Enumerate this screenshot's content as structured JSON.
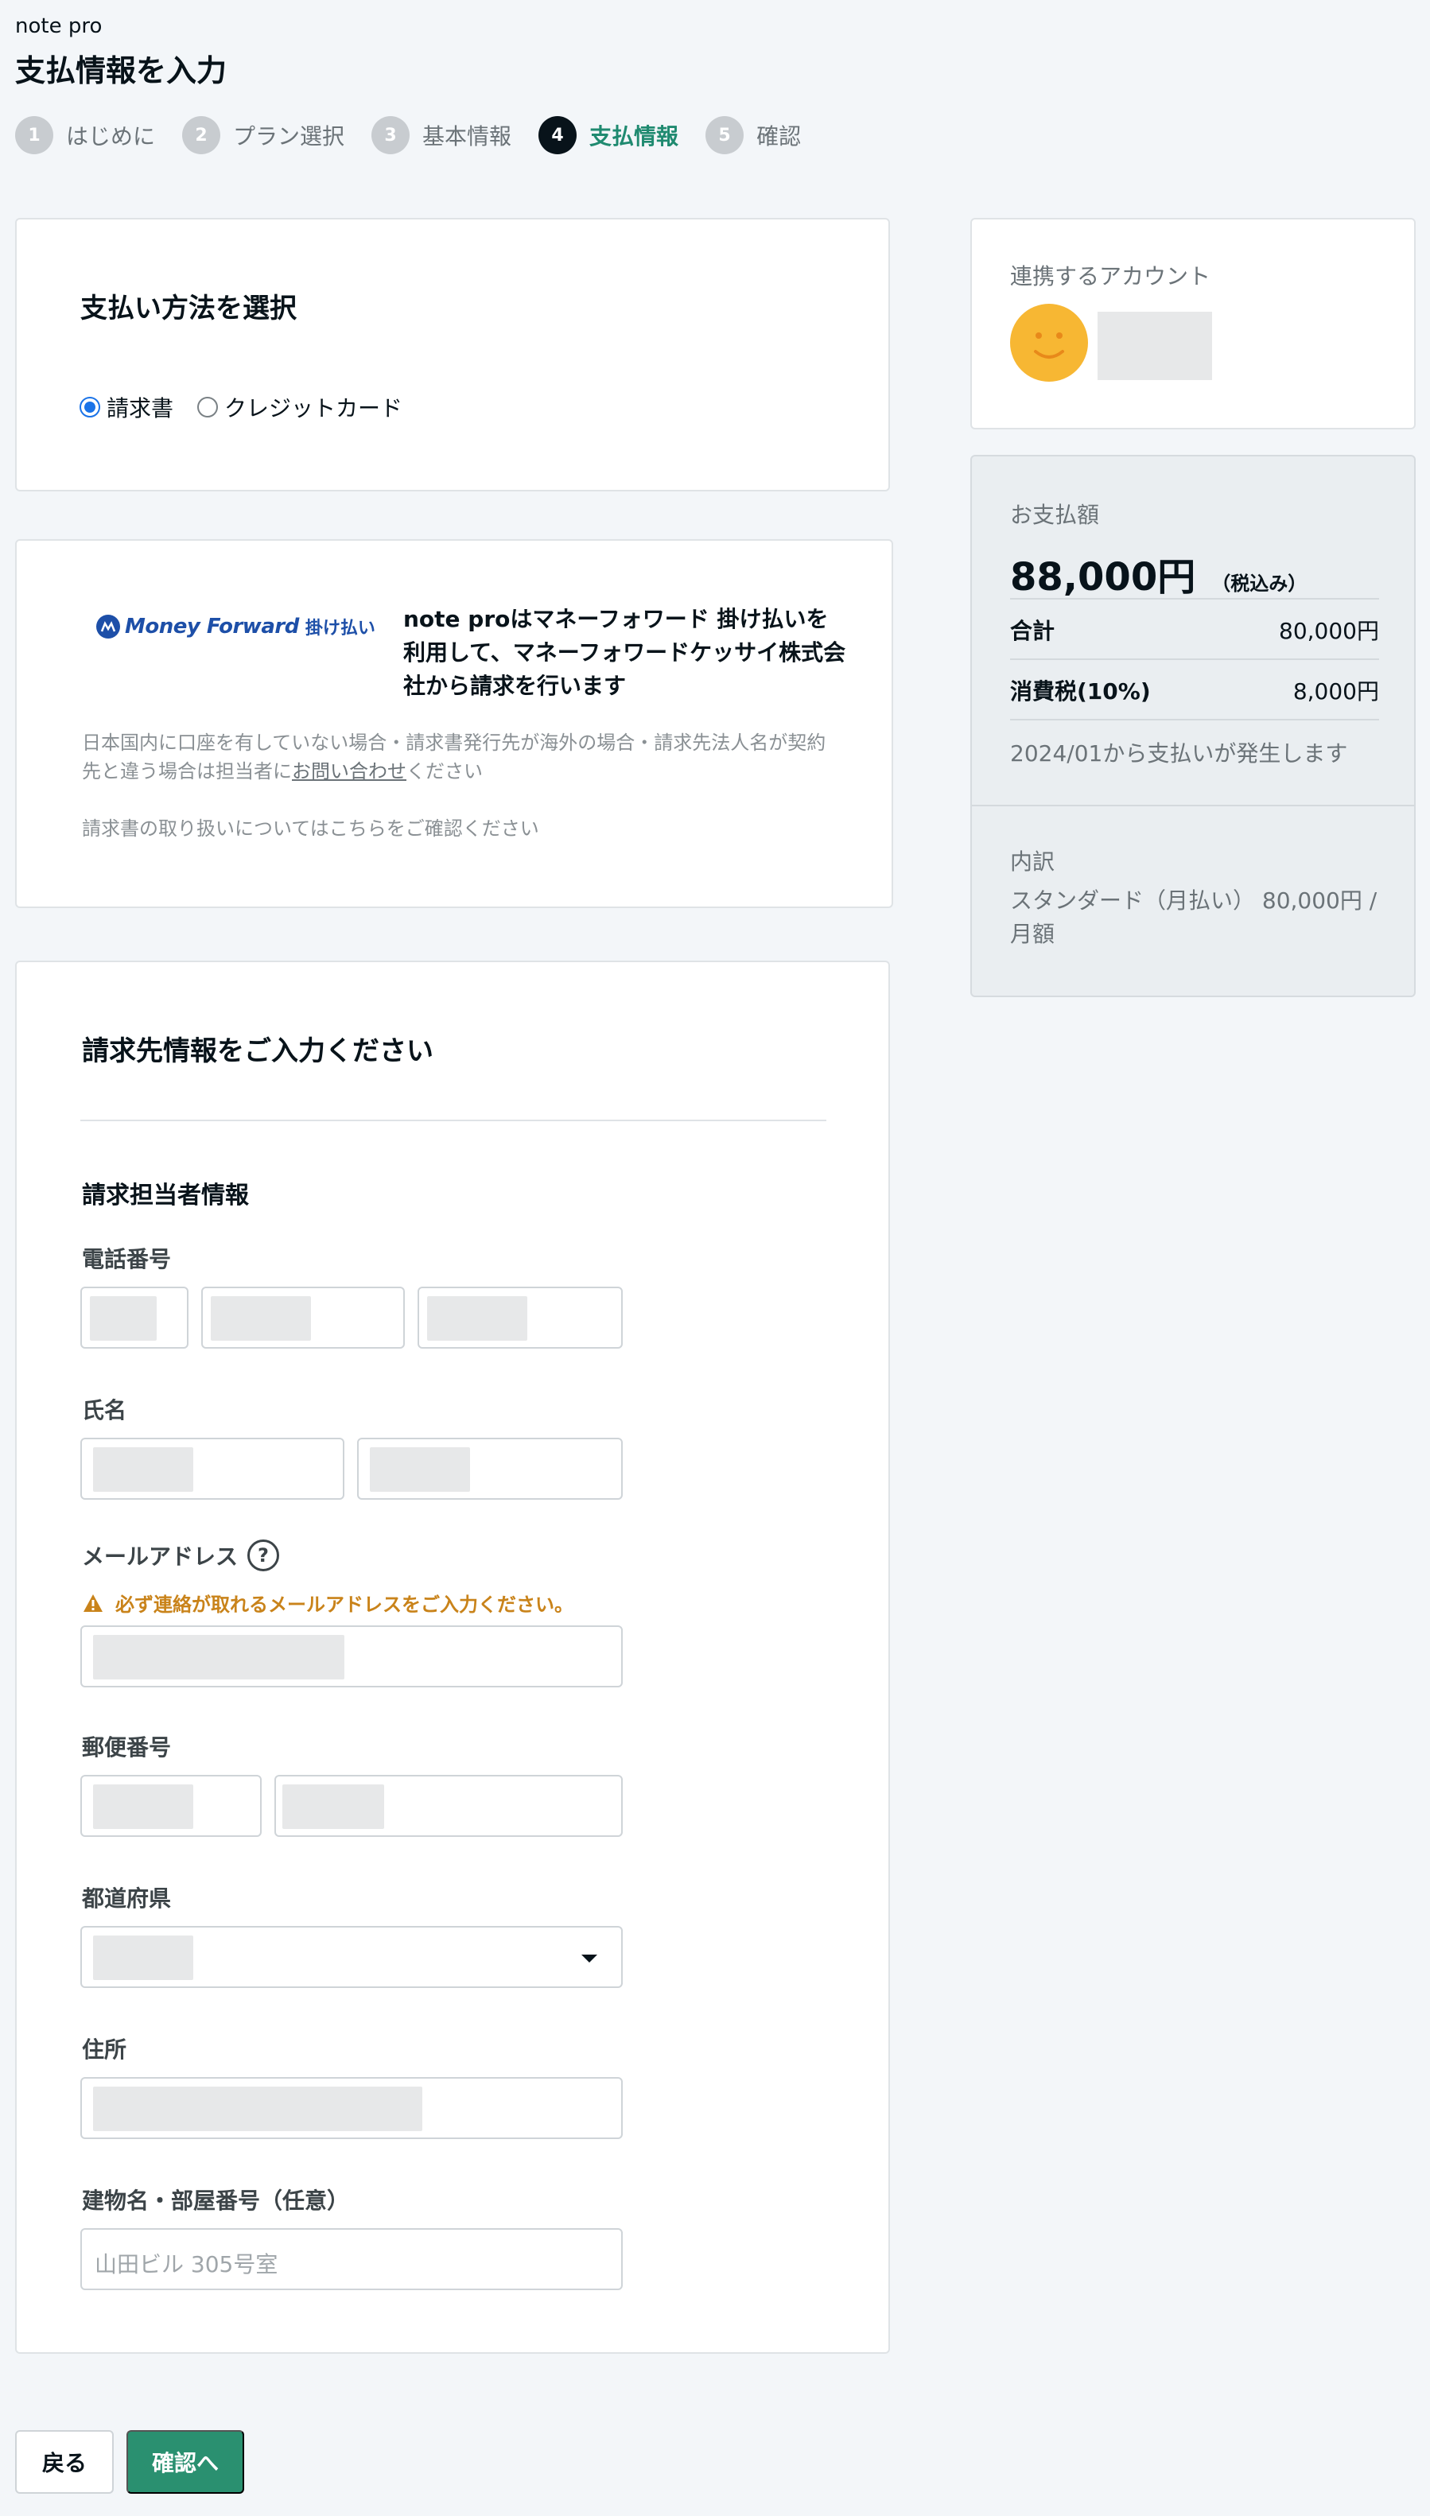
{
  "header": {
    "brand": "note pro",
    "title": "支払情報を入力"
  },
  "steps": [
    {
      "num": "1",
      "label": "はじめに"
    },
    {
      "num": "2",
      "label": "プラン選択"
    },
    {
      "num": "3",
      "label": "基本情報"
    },
    {
      "num": "4",
      "label": "支払情報",
      "active": true
    },
    {
      "num": "5",
      "label": "確認"
    }
  ],
  "payment_method": {
    "title": "支払い方法を選択",
    "options": [
      {
        "label": "請求書",
        "checked": true
      },
      {
        "label": "クレジットカード",
        "checked": false
      }
    ]
  },
  "money_forward": {
    "brand": "Money Forward",
    "sub": "掛け払い",
    "description": "note proはマネーフォワード 掛け払いを利用して、マネーフォワードケッサイ株式会社から請求を行います",
    "note_prefix": "日本国内に口座を有していない場合・請求書発行先が海外の場合・請求先法人名が契約先と違う場合は担当者に",
    "note_link": "お問い合わせ",
    "note_suffix": "ください",
    "note2": "請求書の取り扱いについてはこちらをご確認ください"
  },
  "billing_form": {
    "title": "請求先情報をご入力ください",
    "section": "請求担当者情報",
    "labels": {
      "phone": "電話番号",
      "name": "氏名",
      "email": "メールアドレス",
      "postal": "郵便番号",
      "prefecture": "都道府県",
      "address": "住所",
      "building": "建物名・部屋番号（任意）"
    },
    "email_warning": "必ず連絡が取れるメールアドレスをご入力ください。",
    "building_placeholder": "山田ビル 305号室",
    "help_glyph": "?"
  },
  "sidebar": {
    "account_label": "連携するアカウント",
    "payment_label": "お支払額",
    "payment_amount": "88,000円",
    "payment_tax_note": "（税込み）",
    "rows": [
      {
        "key": "合計",
        "value": "80,000円"
      },
      {
        "key": "消費税(10%)",
        "value": "8,000円"
      }
    ],
    "billing_start": "2024/01から支払いが発生します",
    "breakdown_label": "内訳",
    "breakdown_value": "スタンダード（月払い） 80,000円 / 月額"
  },
  "footer": {
    "back": "戻る",
    "next": "確認へ"
  },
  "colors": {
    "accent": "#2a9070",
    "active_step_text": "#1f8a70",
    "warning": "#c9831a",
    "money_forward": "#1d4fa8"
  }
}
